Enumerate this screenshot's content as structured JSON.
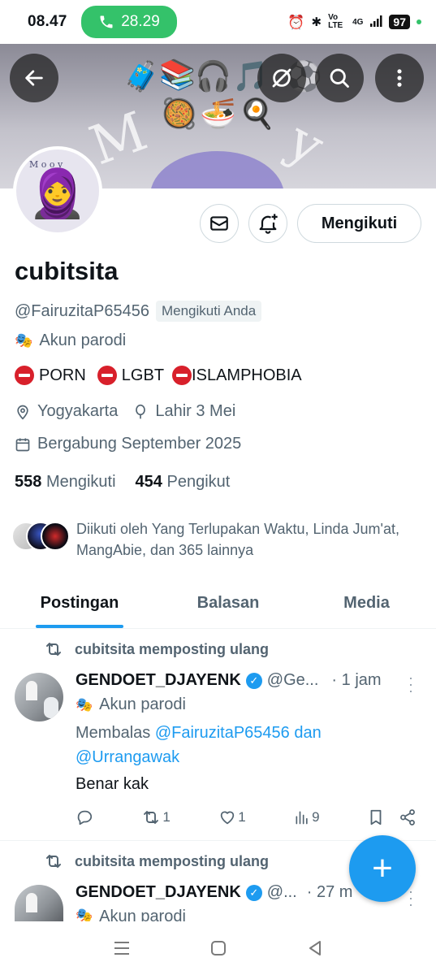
{
  "status_bar": {
    "time": "08.47",
    "call_timer": "28.29",
    "network": "4G",
    "volte": "Vo LTE",
    "battery": "97"
  },
  "header": {
    "banner_letters": [
      "M",
      "y"
    ],
    "banner_emoji": [
      "🧳",
      "📚",
      "🎧",
      "🎵",
      "⚽",
      "🥘",
      "🍜",
      "🍳"
    ]
  },
  "profile": {
    "avatar_caption": "M o o y",
    "name": "cubitsita",
    "handle": "@FairuzitaP65456",
    "follows_you": "Mengikuti Anda",
    "parody_label": "Akun parodi",
    "bio_items": [
      "PORN",
      "LGBT",
      "ISLAMPHOBIA"
    ],
    "location": "Yogyakarta",
    "birthday": "Lahir 3 Mei",
    "joined": "Bergabung September 2025",
    "following_count": "558",
    "following_label": "Mengikuti",
    "followers_count": "454",
    "followers_label": "Pengikut",
    "followed_by": "Diikuti oleh Yang Terlupakan Waktu, Linda Jum'at, MangAbie, dan 365 lainnya",
    "follow_button": "Mengikuti"
  },
  "tabs": [
    {
      "label": "Postingan",
      "active": true
    },
    {
      "label": "Balasan",
      "active": false
    },
    {
      "label": "Media",
      "active": false
    }
  ],
  "posts": [
    {
      "repost_label": "cubitsita memposting ulang",
      "author": "GENDOET_DJAYENK",
      "handle": "@Ge...",
      "time": "· 1 jam",
      "parody": "Akun parodi",
      "reply_prefix": "Membalas",
      "reply_to": "@FairuzitaP65456 dan @Urrangawak",
      "text": "Benar kak",
      "retweets": "1",
      "likes": "1",
      "views": "9"
    },
    {
      "repost_label": "cubitsita memposting ulang",
      "author": "GENDOET_DJAYENK",
      "handle": "@...",
      "time": "· 27 m",
      "parody": "Akun parodi"
    }
  ],
  "colors": {
    "accent": "#1d9bf0",
    "call_green": "#34c26a",
    "stop_red": "#d8202b",
    "muted": "#536471"
  }
}
